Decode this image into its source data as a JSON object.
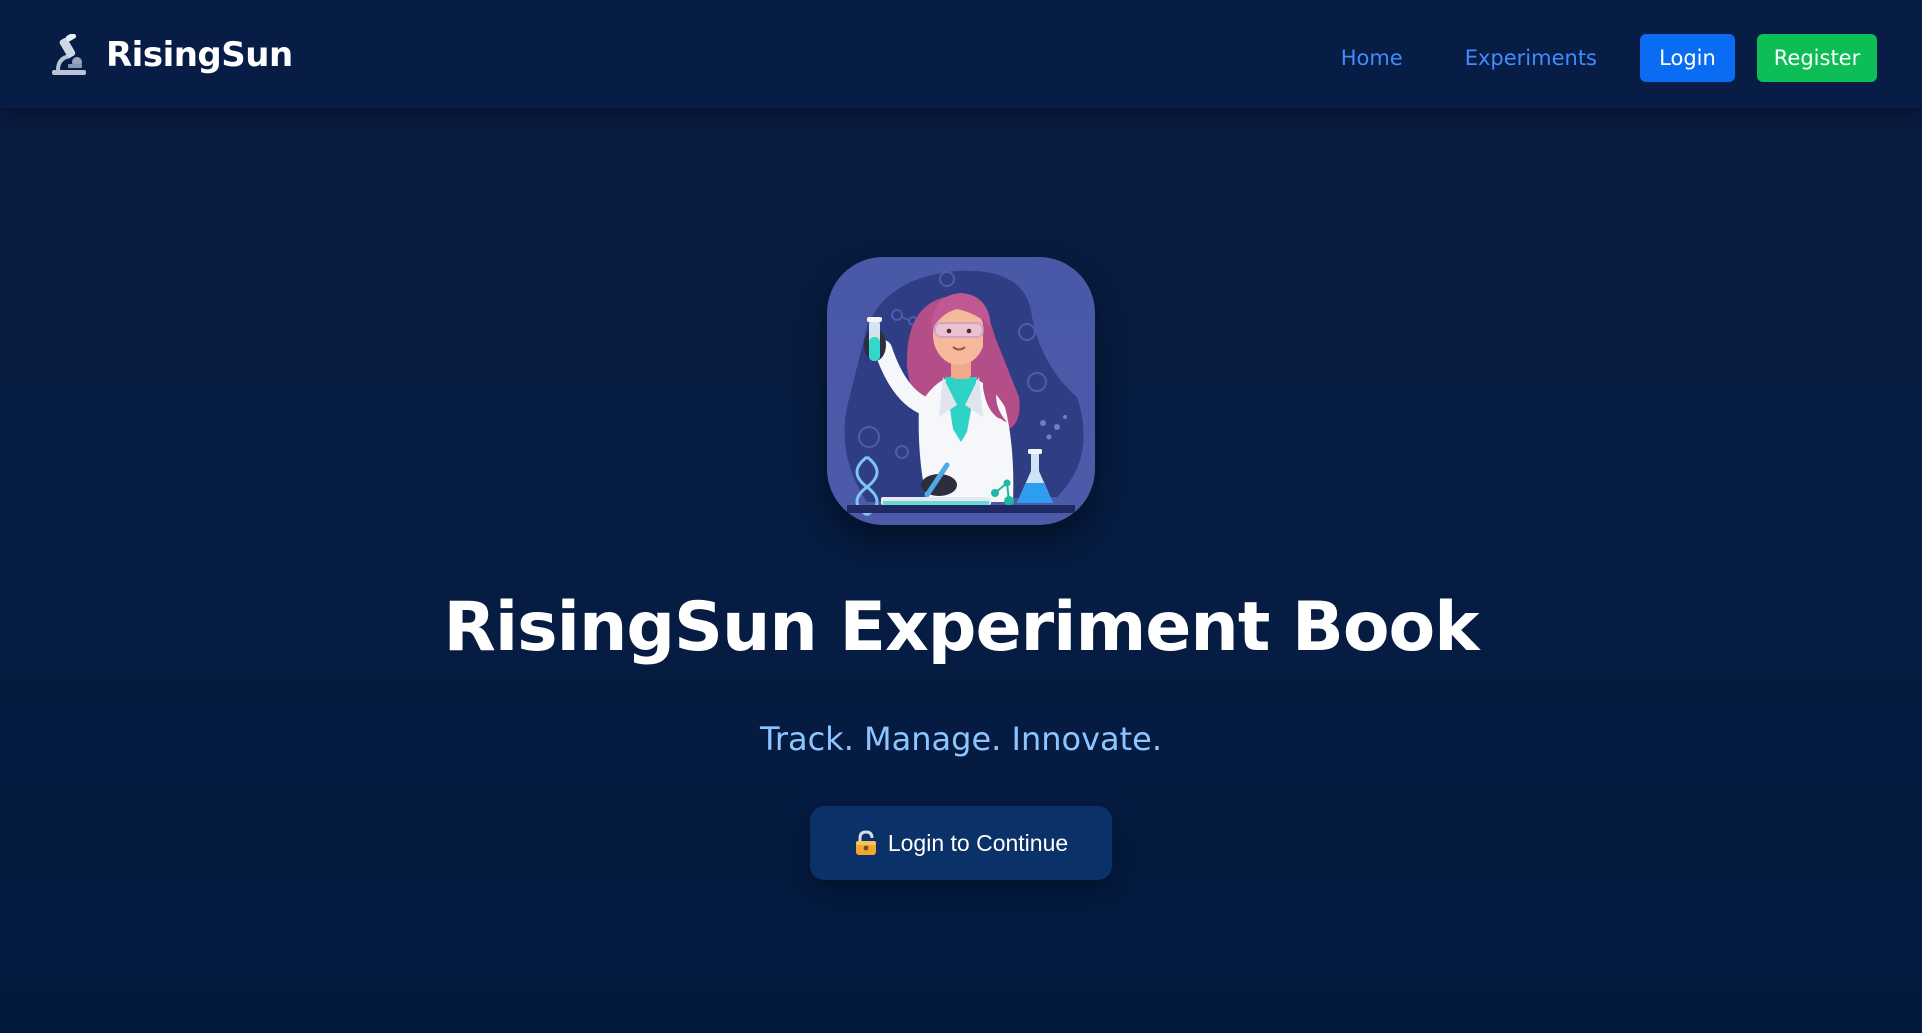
{
  "navbar": {
    "brand_icon": "microscope-icon",
    "brand_name": "RisingSun",
    "links": {
      "home": "Home",
      "experiments": "Experiments"
    },
    "login_label": "Login",
    "register_label": "Register"
  },
  "hero": {
    "image": "scientist-illustration",
    "title": "RisingSun Experiment Book",
    "tagline": "Track. Manage. Innovate.",
    "cta_icon": "lock-icon",
    "cta_label": "Login to Continue"
  },
  "colors": {
    "background": "#061c42",
    "nav_link": "#3f8cff",
    "login_button": "#0a6cf2",
    "register_button": "#0cbe55",
    "tagline": "#8ec5ff",
    "cta_button": "#0a3168"
  }
}
